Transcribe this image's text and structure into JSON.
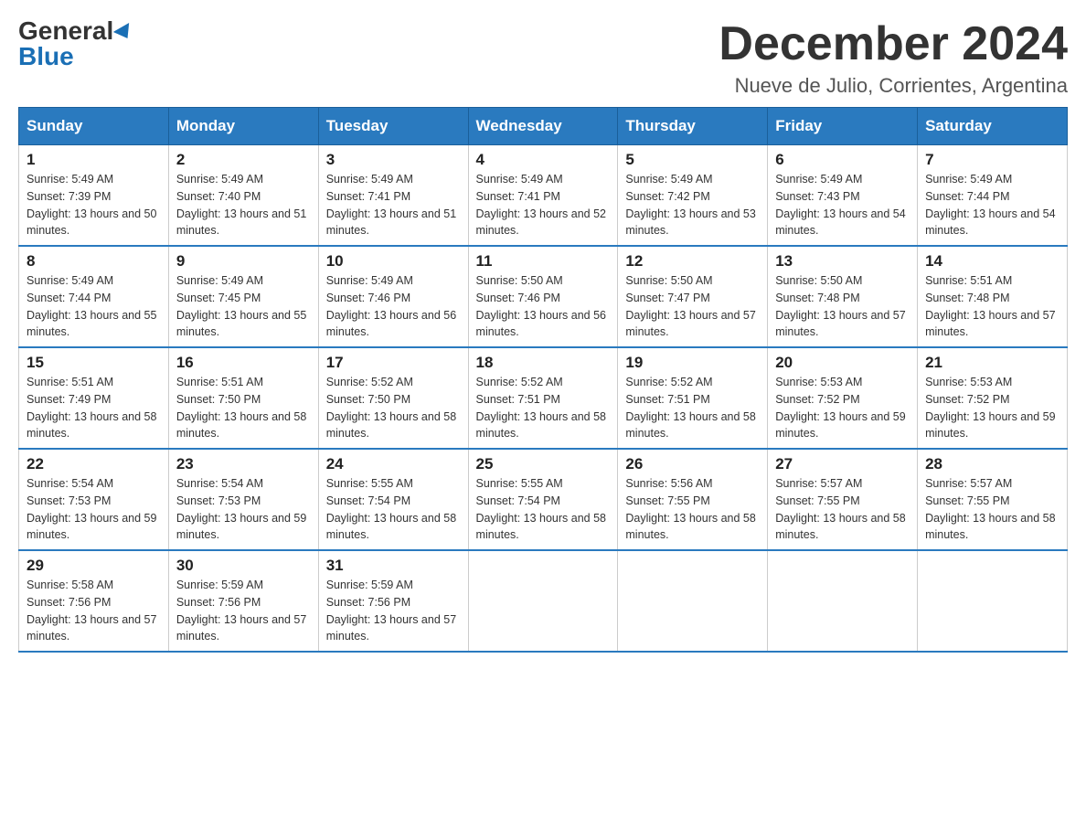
{
  "logo": {
    "general": "General",
    "blue": "Blue"
  },
  "title": "December 2024",
  "location": "Nueve de Julio, Corrientes, Argentina",
  "weekdays": [
    "Sunday",
    "Monday",
    "Tuesday",
    "Wednesday",
    "Thursday",
    "Friday",
    "Saturday"
  ],
  "weeks": [
    [
      {
        "day": "1",
        "sunrise": "5:49 AM",
        "sunset": "7:39 PM",
        "daylight": "13 hours and 50 minutes."
      },
      {
        "day": "2",
        "sunrise": "5:49 AM",
        "sunset": "7:40 PM",
        "daylight": "13 hours and 51 minutes."
      },
      {
        "day": "3",
        "sunrise": "5:49 AM",
        "sunset": "7:41 PM",
        "daylight": "13 hours and 51 minutes."
      },
      {
        "day": "4",
        "sunrise": "5:49 AM",
        "sunset": "7:41 PM",
        "daylight": "13 hours and 52 minutes."
      },
      {
        "day": "5",
        "sunrise": "5:49 AM",
        "sunset": "7:42 PM",
        "daylight": "13 hours and 53 minutes."
      },
      {
        "day": "6",
        "sunrise": "5:49 AM",
        "sunset": "7:43 PM",
        "daylight": "13 hours and 54 minutes."
      },
      {
        "day": "7",
        "sunrise": "5:49 AM",
        "sunset": "7:44 PM",
        "daylight": "13 hours and 54 minutes."
      }
    ],
    [
      {
        "day": "8",
        "sunrise": "5:49 AM",
        "sunset": "7:44 PM",
        "daylight": "13 hours and 55 minutes."
      },
      {
        "day": "9",
        "sunrise": "5:49 AM",
        "sunset": "7:45 PM",
        "daylight": "13 hours and 55 minutes."
      },
      {
        "day": "10",
        "sunrise": "5:49 AM",
        "sunset": "7:46 PM",
        "daylight": "13 hours and 56 minutes."
      },
      {
        "day": "11",
        "sunrise": "5:50 AM",
        "sunset": "7:46 PM",
        "daylight": "13 hours and 56 minutes."
      },
      {
        "day": "12",
        "sunrise": "5:50 AM",
        "sunset": "7:47 PM",
        "daylight": "13 hours and 57 minutes."
      },
      {
        "day": "13",
        "sunrise": "5:50 AM",
        "sunset": "7:48 PM",
        "daylight": "13 hours and 57 minutes."
      },
      {
        "day": "14",
        "sunrise": "5:51 AM",
        "sunset": "7:48 PM",
        "daylight": "13 hours and 57 minutes."
      }
    ],
    [
      {
        "day": "15",
        "sunrise": "5:51 AM",
        "sunset": "7:49 PM",
        "daylight": "13 hours and 58 minutes."
      },
      {
        "day": "16",
        "sunrise": "5:51 AM",
        "sunset": "7:50 PM",
        "daylight": "13 hours and 58 minutes."
      },
      {
        "day": "17",
        "sunrise": "5:52 AM",
        "sunset": "7:50 PM",
        "daylight": "13 hours and 58 minutes."
      },
      {
        "day": "18",
        "sunrise": "5:52 AM",
        "sunset": "7:51 PM",
        "daylight": "13 hours and 58 minutes."
      },
      {
        "day": "19",
        "sunrise": "5:52 AM",
        "sunset": "7:51 PM",
        "daylight": "13 hours and 58 minutes."
      },
      {
        "day": "20",
        "sunrise": "5:53 AM",
        "sunset": "7:52 PM",
        "daylight": "13 hours and 59 minutes."
      },
      {
        "day": "21",
        "sunrise": "5:53 AM",
        "sunset": "7:52 PM",
        "daylight": "13 hours and 59 minutes."
      }
    ],
    [
      {
        "day": "22",
        "sunrise": "5:54 AM",
        "sunset": "7:53 PM",
        "daylight": "13 hours and 59 minutes."
      },
      {
        "day": "23",
        "sunrise": "5:54 AM",
        "sunset": "7:53 PM",
        "daylight": "13 hours and 59 minutes."
      },
      {
        "day": "24",
        "sunrise": "5:55 AM",
        "sunset": "7:54 PM",
        "daylight": "13 hours and 58 minutes."
      },
      {
        "day": "25",
        "sunrise": "5:55 AM",
        "sunset": "7:54 PM",
        "daylight": "13 hours and 58 minutes."
      },
      {
        "day": "26",
        "sunrise": "5:56 AM",
        "sunset": "7:55 PM",
        "daylight": "13 hours and 58 minutes."
      },
      {
        "day": "27",
        "sunrise": "5:57 AM",
        "sunset": "7:55 PM",
        "daylight": "13 hours and 58 minutes."
      },
      {
        "day": "28",
        "sunrise": "5:57 AM",
        "sunset": "7:55 PM",
        "daylight": "13 hours and 58 minutes."
      }
    ],
    [
      {
        "day": "29",
        "sunrise": "5:58 AM",
        "sunset": "7:56 PM",
        "daylight": "13 hours and 57 minutes."
      },
      {
        "day": "30",
        "sunrise": "5:59 AM",
        "sunset": "7:56 PM",
        "daylight": "13 hours and 57 minutes."
      },
      {
        "day": "31",
        "sunrise": "5:59 AM",
        "sunset": "7:56 PM",
        "daylight": "13 hours and 57 minutes."
      },
      null,
      null,
      null,
      null
    ]
  ]
}
